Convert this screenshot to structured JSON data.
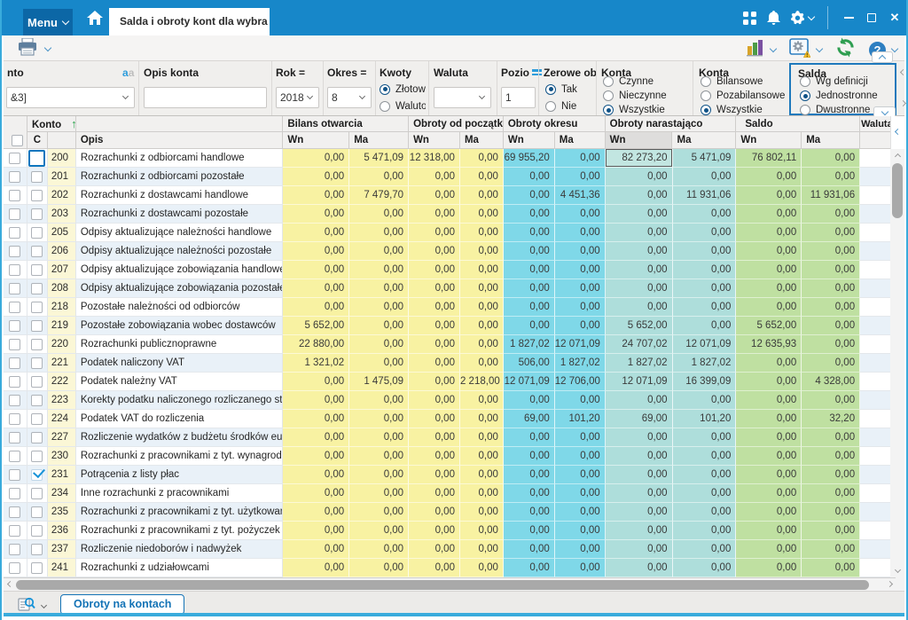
{
  "titlebar": {
    "menu_label": "Menu",
    "tab_title": "Salda i obroty kont dla wybra"
  },
  "filters": {
    "konto": {
      "label": "nto",
      "value": "&3]"
    },
    "opis_konta": {
      "label": "Opis konta",
      "value": ""
    },
    "rok": {
      "label": "Rok =",
      "value": "2018"
    },
    "okres": {
      "label": "Okres =",
      "value": "8"
    },
    "kwoty": {
      "label": "Kwoty",
      "options": [
        "Złotow",
        "Waluto"
      ],
      "selected": "Złotow"
    },
    "waluta": {
      "label": "Waluta",
      "value": ""
    },
    "poziom": {
      "label": "Pozio",
      "value": "1"
    },
    "zerowe": {
      "label": "Zerowe obro",
      "options": [
        "Tak",
        "Nie"
      ],
      "selected": "Tak"
    },
    "konta_stan": {
      "label": "Konta",
      "options": [
        "Czynne",
        "Nieczynne",
        "Wszystkie"
      ],
      "selected": "Wszystkie"
    },
    "konta_typ": {
      "label": "Konta",
      "options": [
        "Bilansowe",
        "Pozabilansowe",
        "Wszystkie"
      ],
      "selected": "Wszystkie"
    },
    "salda": {
      "label": "Salda",
      "options": [
        "Wg definicji",
        "Jednostronne",
        "Dwustronne"
      ],
      "selected": "Jednostronne"
    }
  },
  "table": {
    "konto_header": "Konto",
    "c_header": "C",
    "opis_header": "Opis",
    "groups": {
      "bilans": "Bilans otwarcia",
      "od_poczatku": "Obroty od początku r",
      "okresu": "Obroty okresu",
      "narastajaco": "Obroty narastająco",
      "saldo": "Saldo",
      "waluta": "Waluta"
    },
    "sub_wn": "Wn",
    "sub_ma": "Ma",
    "focused_c_row": "200",
    "selected_cell": {
      "row": "200",
      "col": 6
    },
    "rows": [
      {
        "konto": "200",
        "opis": "Rozrachunki z odbiorcami handlowe",
        "c_checked": false,
        "v": [
          "0,00",
          "5 471,09",
          "12 318,00",
          "0,00",
          "69 955,20",
          "0,00",
          "82 273,20",
          "5 471,09",
          "76 802,11",
          "0,00"
        ]
      },
      {
        "konto": "201",
        "opis": "Rozrachunki z odbiorcami pozostałe",
        "c_checked": false,
        "v": [
          "0,00",
          "0,00",
          "0,00",
          "0,00",
          "0,00",
          "0,00",
          "0,00",
          "0,00",
          "0,00",
          "0,00"
        ]
      },
      {
        "konto": "202",
        "opis": "Rozrachunki z dostawcami handlowe",
        "c_checked": false,
        "v": [
          "0,00",
          "7 479,70",
          "0,00",
          "0,00",
          "0,00",
          "4 451,36",
          "0,00",
          "11 931,06",
          "0,00",
          "11 931,06"
        ]
      },
      {
        "konto": "203",
        "opis": "Rozrachunki z dostawcami pozostałe",
        "c_checked": false,
        "v": [
          "0,00",
          "0,00",
          "0,00",
          "0,00",
          "0,00",
          "0,00",
          "0,00",
          "0,00",
          "0,00",
          "0,00"
        ]
      },
      {
        "konto": "205",
        "opis": "Odpisy aktualizujące należności handlowe",
        "c_checked": false,
        "v": [
          "0,00",
          "0,00",
          "0,00",
          "0,00",
          "0,00",
          "0,00",
          "0,00",
          "0,00",
          "0,00",
          "0,00"
        ]
      },
      {
        "konto": "206",
        "opis": "Odpisy aktualizujące należności pozostałe",
        "c_checked": false,
        "v": [
          "0,00",
          "0,00",
          "0,00",
          "0,00",
          "0,00",
          "0,00",
          "0,00",
          "0,00",
          "0,00",
          "0,00"
        ]
      },
      {
        "konto": "207",
        "opis": "Odpisy aktualizujące zobowiązania handlowe",
        "c_checked": false,
        "v": [
          "0,00",
          "0,00",
          "0,00",
          "0,00",
          "0,00",
          "0,00",
          "0,00",
          "0,00",
          "0,00",
          "0,00"
        ]
      },
      {
        "konto": "208",
        "opis": "Odpisy aktualizujące zobowiązania pozostałe",
        "c_checked": false,
        "v": [
          "0,00",
          "0,00",
          "0,00",
          "0,00",
          "0,00",
          "0,00",
          "0,00",
          "0,00",
          "0,00",
          "0,00"
        ]
      },
      {
        "konto": "218",
        "opis": "Pozostałe należności od odbiorców",
        "c_checked": false,
        "v": [
          "0,00",
          "0,00",
          "0,00",
          "0,00",
          "0,00",
          "0,00",
          "0,00",
          "0,00",
          "0,00",
          "0,00"
        ]
      },
      {
        "konto": "219",
        "opis": "Pozostałe zobowiązania wobec dostawców",
        "c_checked": false,
        "v": [
          "5 652,00",
          "0,00",
          "0,00",
          "0,00",
          "0,00",
          "0,00",
          "5 652,00",
          "0,00",
          "5 652,00",
          "0,00"
        ]
      },
      {
        "konto": "220",
        "opis": "Rozrachunki publicznoprawne",
        "c_checked": false,
        "v": [
          "22 880,00",
          "0,00",
          "0,00",
          "0,00",
          "1 827,02",
          "12 071,09",
          "24 707,02",
          "12 071,09",
          "12 635,93",
          "0,00"
        ]
      },
      {
        "konto": "221",
        "opis": "Podatek naliczony VAT",
        "c_checked": false,
        "v": [
          "1 321,02",
          "0,00",
          "0,00",
          "0,00",
          "506,00",
          "1 827,02",
          "1 827,02",
          "1 827,02",
          "0,00",
          "0,00"
        ]
      },
      {
        "konto": "222",
        "opis": "Podatek należny VAT",
        "c_checked": false,
        "v": [
          "0,00",
          "1 475,09",
          "0,00",
          "2 218,00",
          "12 071,09",
          "12 706,00",
          "12 071,09",
          "16 399,09",
          "0,00",
          "4 328,00"
        ]
      },
      {
        "konto": "223",
        "opis": "Korekty podatku naliczonego rozliczanego strukturą",
        "c_checked": false,
        "v": [
          "0,00",
          "0,00",
          "0,00",
          "0,00",
          "0,00",
          "0,00",
          "0,00",
          "0,00",
          "0,00",
          "0,00"
        ]
      },
      {
        "konto": "224",
        "opis": "Podatek VAT do rozliczenia",
        "c_checked": false,
        "v": [
          "0,00",
          "0,00",
          "0,00",
          "0,00",
          "69,00",
          "101,20",
          "69,00",
          "101,20",
          "0,00",
          "32,20"
        ]
      },
      {
        "konto": "227",
        "opis": "Rozliczenie wydatków z budżetu środków europejskich",
        "c_checked": false,
        "v": [
          "0,00",
          "0,00",
          "0,00",
          "0,00",
          "0,00",
          "0,00",
          "0,00",
          "0,00",
          "0,00",
          "0,00"
        ]
      },
      {
        "konto": "230",
        "opis": "Rozrachunki z pracownikami z tyt. wynagrodzeń",
        "c_checked": false,
        "v": [
          "0,00",
          "0,00",
          "0,00",
          "0,00",
          "0,00",
          "0,00",
          "0,00",
          "0,00",
          "0,00",
          "0,00"
        ]
      },
      {
        "konto": "231",
        "opis": "Potrącenia z listy płac",
        "c_checked": true,
        "v": [
          "0,00",
          "0,00",
          "0,00",
          "0,00",
          "0,00",
          "0,00",
          "0,00",
          "0,00",
          "0,00",
          "0,00"
        ]
      },
      {
        "konto": "234",
        "opis": "Inne rozrachunki z pracownikami",
        "c_checked": false,
        "v": [
          "0,00",
          "0,00",
          "0,00",
          "0,00",
          "0,00",
          "0,00",
          "0,00",
          "0,00",
          "0,00",
          "0,00"
        ]
      },
      {
        "konto": "235",
        "opis": "Rozrachunki z pracownikami z tyt. użytkowania",
        "c_checked": false,
        "v": [
          "0,00",
          "0,00",
          "0,00",
          "0,00",
          "0,00",
          "0,00",
          "0,00",
          "0,00",
          "0,00",
          "0,00"
        ]
      },
      {
        "konto": "236",
        "opis": "Rozrachunki z pracownikami z tyt. pożyczek i świadczeń",
        "c_checked": false,
        "v": [
          "0,00",
          "0,00",
          "0,00",
          "0,00",
          "0,00",
          "0,00",
          "0,00",
          "0,00",
          "0,00",
          "0,00"
        ]
      },
      {
        "konto": "237",
        "opis": "Rozliczenie niedoborów i nadwyżek",
        "c_checked": false,
        "v": [
          "0,00",
          "0,00",
          "0,00",
          "0,00",
          "0,00",
          "0,00",
          "0,00",
          "0,00",
          "0,00",
          "0,00"
        ]
      },
      {
        "konto": "241",
        "opis": "Rozrachunki z udziałowcami",
        "c_checked": false,
        "v": [
          "0,00",
          "0,00",
          "0,00",
          "0,00",
          "0,00",
          "0,00",
          "0,00",
          "0,00",
          "0,00",
          "0,00"
        ]
      }
    ]
  },
  "bottom": {
    "tab_label": "Obroty na kontach"
  }
}
